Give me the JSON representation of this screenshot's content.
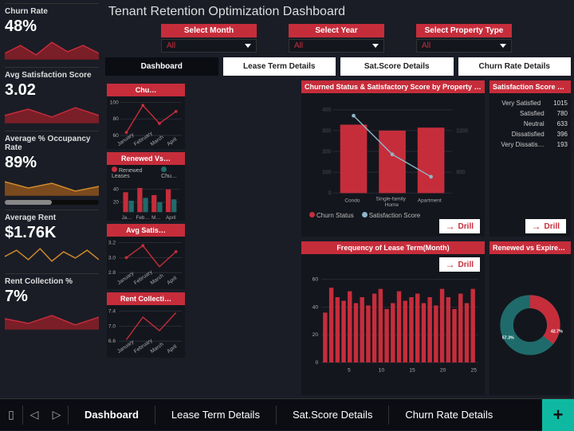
{
  "title": "Tenant Retention Optimization Dashboard",
  "filters": {
    "month": {
      "head": "Select Month",
      "value": "All"
    },
    "year": {
      "head": "Select Year",
      "value": "All"
    },
    "ptype": {
      "head": "Select Property Type",
      "value": "All"
    }
  },
  "tabs": [
    "Dashboard",
    "Lease Term Details",
    "Sat.Score Details",
    "Churn Rate Details"
  ],
  "bottom_pages": [
    "Dashboard",
    "Lease Term Details",
    "Sat.Score Details",
    "Churn Rate Details"
  ],
  "kpi": {
    "churn": {
      "label": "Churn Rate",
      "value": "48%"
    },
    "sat": {
      "label": "Avg Satisfaction Score",
      "value": "3.02"
    },
    "occ": {
      "label": "Average % Occupancy Rate",
      "value": "89%"
    },
    "rent": {
      "label": "Average Rent",
      "value": "$1.76K"
    },
    "coll": {
      "label": "Rent Collection %",
      "value": "7%"
    }
  },
  "cards": {
    "ptype": "Churned Status & Satisfactory Score by Property T…",
    "survey": "Satisfaction Score by Tenant Survey Response",
    "renew": "Renewed vs Expired Lease",
    "freq": "Frequency of Lease Term(Month)",
    "r_churn": "Chu…",
    "r_renew": "Renewed Vs…",
    "r_sat": "Avg Satis…",
    "r_coll": "Rent Collecti…"
  },
  "drill_label": "Drill",
  "legends": {
    "ptype": [
      "Churn Status",
      "Satisfaction Score"
    ],
    "renew_right": [
      "Renewed Leases",
      "Chu…"
    ]
  },
  "chart_data": [
    {
      "id": "churn_sat_by_ptype",
      "type": "bar",
      "categories": [
        "Condo",
        "Single-family Home",
        "Apartment"
      ],
      "series": [
        {
          "name": "Churn Status",
          "values": [
            330,
            300,
            310
          ]
        },
        {
          "name": "Satisfaction Score",
          "values": [
            1400,
            900,
            600
          ],
          "rendered_as": "line",
          "axis": "right"
        }
      ],
      "ylim_left": [
        0,
        400
      ],
      "ylim_right": [
        0,
        1400
      ],
      "yticks_left": [
        0,
        100,
        200,
        300,
        400
      ],
      "yticks_right": [
        600,
        1200
      ]
    },
    {
      "id": "survey_bar",
      "type": "bar",
      "orientation": "horizontal",
      "categories": [
        "Very Satisfied",
        "Satisfied",
        "Neutral",
        "Dissatisfied",
        "Very Dissatis…"
      ],
      "values": [
        1015,
        780,
        633,
        396,
        193
      ]
    },
    {
      "id": "renew_expired_donut",
      "type": "pie",
      "series": [
        {
          "name": "Expired",
          "value": 57.3,
          "color": "#1f6b6b"
        },
        {
          "name": "Renewed",
          "value": 42.7,
          "color": "#c62d3b"
        }
      ],
      "labels": [
        "57.3%",
        "42.7%"
      ]
    },
    {
      "id": "lease_term_freq",
      "type": "bar",
      "x": [
        1,
        2,
        3,
        4,
        5,
        6,
        7,
        8,
        9,
        10,
        11,
        12,
        13,
        14,
        15,
        16,
        17,
        18,
        19,
        20,
        21,
        22,
        23,
        24,
        25
      ],
      "values": [
        42,
        63,
        55,
        52,
        60,
        50,
        55,
        48,
        58,
        62,
        45,
        50,
        60,
        52,
        55,
        58,
        50,
        55,
        48,
        62,
        55,
        45,
        58,
        50,
        62
      ],
      "ylim": [
        0,
        70
      ],
      "yticks": [
        0,
        20,
        40,
        60
      ],
      "xticks_shown": [
        5,
        10,
        15,
        20,
        25
      ]
    },
    {
      "id": "right_churn_line",
      "type": "line",
      "x": [
        "January",
        "February",
        "March",
        "April"
      ],
      "values": [
        62,
        95,
        70,
        85
      ],
      "ylim": [
        60,
        100
      ],
      "yticks": [
        60,
        80,
        100
      ]
    },
    {
      "id": "right_renew_bar",
      "type": "bar",
      "x": [
        "Ja…",
        "Feb…",
        "M…",
        "April"
      ],
      "series": [
        {
          "name": "Renewed Leases",
          "values": [
            38,
            45,
            30,
            42
          ]
        },
        {
          "name": "Churned",
          "values": [
            18,
            22,
            15,
            20
          ]
        }
      ],
      "ylim": [
        0,
        50
      ],
      "yticks": [
        20,
        40
      ]
    },
    {
      "id": "right_avg_sat_line",
      "type": "line",
      "x": [
        "January",
        "February",
        "March",
        "April"
      ],
      "values": [
        3.0,
        3.2,
        2.9,
        3.1
      ],
      "ylim": [
        2.8,
        3.2
      ],
      "yticks": [
        2.8,
        3.0,
        3.2
      ]
    },
    {
      "id": "right_rent_coll_line",
      "type": "line",
      "x": [
        "January",
        "February",
        "March",
        "April"
      ],
      "values": [
        6.6,
        7.2,
        6.8,
        7.4
      ],
      "ylim": [
        6.6,
        7.4
      ],
      "yticks": [
        6.6,
        7.0,
        7.4
      ]
    }
  ]
}
